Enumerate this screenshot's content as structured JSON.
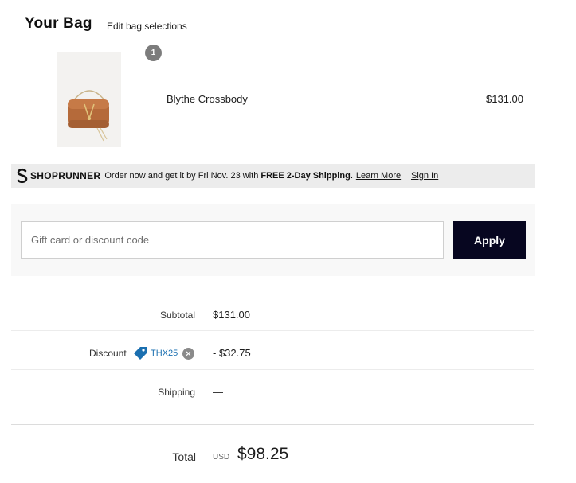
{
  "header": {
    "title": "Your Bag",
    "edit_link": "Edit bag selections"
  },
  "item": {
    "quantity": "1",
    "name": "Blythe Crossbody",
    "price": "$131.00"
  },
  "shoprunner": {
    "brand": "SHOPRUNNER",
    "message": "Order now and get it by Fri Nov. 23 with",
    "highlight": "FREE 2-Day Shipping.",
    "learn_more": "Learn More",
    "separator": "|",
    "sign_in": "Sign In"
  },
  "discount_form": {
    "placeholder": "Gift card or discount code",
    "value": "",
    "apply_label": "Apply"
  },
  "summary": {
    "subtotal_label": "Subtotal",
    "subtotal_value": "$131.00",
    "discount_label": "Discount",
    "discount_code": "THX25",
    "discount_value": "- $32.75",
    "shipping_label": "Shipping",
    "shipping_value": "—",
    "total_label": "Total",
    "currency": "USD",
    "total_value": "$98.25"
  },
  "colors": {
    "button_bg": "#070620",
    "link_blue": "#1a6fb0",
    "badge_gray": "#7c7c7c",
    "shoprunner_bg": "#ececec"
  },
  "icons": {
    "product_image": "tan-leather-crossbody-bag",
    "shoprunner_logo": "shoprunner-s-icon",
    "discount_tag": "tag-icon",
    "remove": "close-circle-icon"
  }
}
